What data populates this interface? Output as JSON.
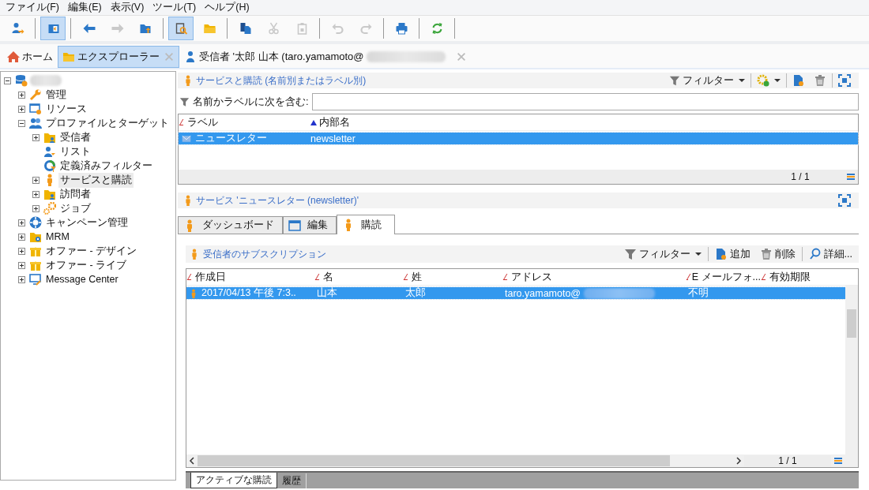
{
  "menu_bar": [
    "ファイル(F)",
    "編集(E)",
    "表示(V)",
    "ツール(T)",
    "ヘルプ(H)"
  ],
  "toolbar": [
    {
      "kind": "user-arrow",
      "pressed": false,
      "disabled": false
    },
    {
      "kind": "separator"
    },
    {
      "kind": "panel",
      "pressed": true,
      "disabled": false
    },
    {
      "kind": "separator"
    },
    {
      "kind": "back",
      "pressed": false,
      "disabled": false
    },
    {
      "kind": "forward",
      "pressed": false,
      "disabled": true
    },
    {
      "kind": "folder-up",
      "pressed": false,
      "disabled": false
    },
    {
      "kind": "separator"
    },
    {
      "kind": "search-doc",
      "pressed": true,
      "disabled": false
    },
    {
      "kind": "folder",
      "pressed": false,
      "disabled": false
    },
    {
      "kind": "separator"
    },
    {
      "kind": "copy",
      "pressed": false,
      "disabled": false
    },
    {
      "kind": "cut",
      "pressed": false,
      "disabled": true
    },
    {
      "kind": "paste",
      "pressed": false,
      "disabled": true
    },
    {
      "kind": "separator"
    },
    {
      "kind": "undo",
      "pressed": false,
      "disabled": true
    },
    {
      "kind": "redo",
      "pressed": false,
      "disabled": true
    },
    {
      "kind": "separator"
    },
    {
      "kind": "print",
      "pressed": false,
      "disabled": false
    },
    {
      "kind": "separator"
    },
    {
      "kind": "refresh",
      "pressed": false,
      "disabled": false
    },
    {
      "kind": "separator"
    }
  ],
  "tabs": [
    {
      "label": "ホーム",
      "kind": "home",
      "selected": false,
      "closable": false
    },
    {
      "label": "エクスプローラー",
      "kind": "folder",
      "selected": true,
      "closable": true
    },
    {
      "label": "受信者 '太郎 山本 (taro.yamamoto@",
      "kind": "person",
      "selected": false,
      "closable": true
    }
  ],
  "tree": {
    "kind": "database",
    "expanded": true,
    "children": [
      {
        "label": "管理",
        "kind": "wrench",
        "expanded": false,
        "selected": false
      },
      {
        "label": "リソース",
        "kind": "resource",
        "expanded": false,
        "selected": false
      },
      {
        "label": "プロファイルとターゲット",
        "kind": "people",
        "expanded": true,
        "selected": false,
        "children": [
          {
            "label": "受信者",
            "kind": "folder-person",
            "expanded": false,
            "selected": false
          },
          {
            "label": "リスト",
            "kind": "list-people",
            "selected": false
          },
          {
            "label": "定義済みフィルター",
            "kind": "filter-ring",
            "selected": false
          },
          {
            "label": "サービスと購読",
            "kind": "person-orange",
            "expanded": false,
            "selected": true
          },
          {
            "label": "訪問者",
            "kind": "folder-person",
            "expanded": false,
            "selected": false
          },
          {
            "label": "ジョブ",
            "kind": "gears",
            "expanded": false,
            "selected": false
          }
        ]
      },
      {
        "label": "キャンペーン管理",
        "kind": "lifebuoy",
        "expanded": false,
        "selected": false
      },
      {
        "label": "MRM",
        "kind": "folder-gear",
        "expanded": false,
        "selected": false
      },
      {
        "label": "オファー - デザイン",
        "kind": "gift",
        "expanded": false,
        "selected": false
      },
      {
        "label": "オファー - ライブ",
        "kind": "gift",
        "expanded": false,
        "selected": false
      },
      {
        "label": "Message Center",
        "kind": "monitor",
        "expanded": false,
        "selected": false
      }
    ]
  },
  "services_panel": {
    "title": "サービスと購読 (名前別またはラベル別)",
    "filter_button": "フィルター",
    "search_label": "名前かラベルに次を含む:",
    "columns": [
      {
        "label": "ラベル",
        "sorted": false
      },
      {
        "label": "内部名",
        "sorted": true
      }
    ],
    "rows": [
      {
        "cells": [
          "ニュースレター",
          "newsletter"
        ],
        "selected": true
      }
    ],
    "pager": "1 / 1"
  },
  "detail_panel": {
    "title": "サービス 'ニュースレター (newsletter)'",
    "tabs": [
      {
        "label": "ダッシュボード",
        "kind": "person-orange",
        "selected": false
      },
      {
        "label": "編集",
        "kind": "window",
        "selected": false
      },
      {
        "label": "購読",
        "kind": "person-orange",
        "selected": true
      }
    ],
    "section_title": "受信者のサブスクリプション",
    "buttons": [
      {
        "kind": "filter",
        "label": "フィルター"
      },
      {
        "kind": "add",
        "label": "追加"
      },
      {
        "kind": "delete",
        "label": "削除"
      },
      {
        "kind": "detail",
        "label": "詳細..."
      }
    ],
    "columns": [
      "作成日",
      "名",
      "姓",
      "アドレス",
      "E メールフォ...",
      "有効期限"
    ],
    "rows": [
      {
        "selected": true,
        "cells": [
          "2017/04/13 午後 7:3..",
          "山本",
          "太郎",
          "taro.yamamoto@",
          "不明"
        ]
      }
    ],
    "pager": "1 / 1",
    "bottom_tabs": [
      {
        "label": "アクティブな購読",
        "selected": true
      },
      {
        "label": "履歴",
        "selected": false
      }
    ]
  }
}
